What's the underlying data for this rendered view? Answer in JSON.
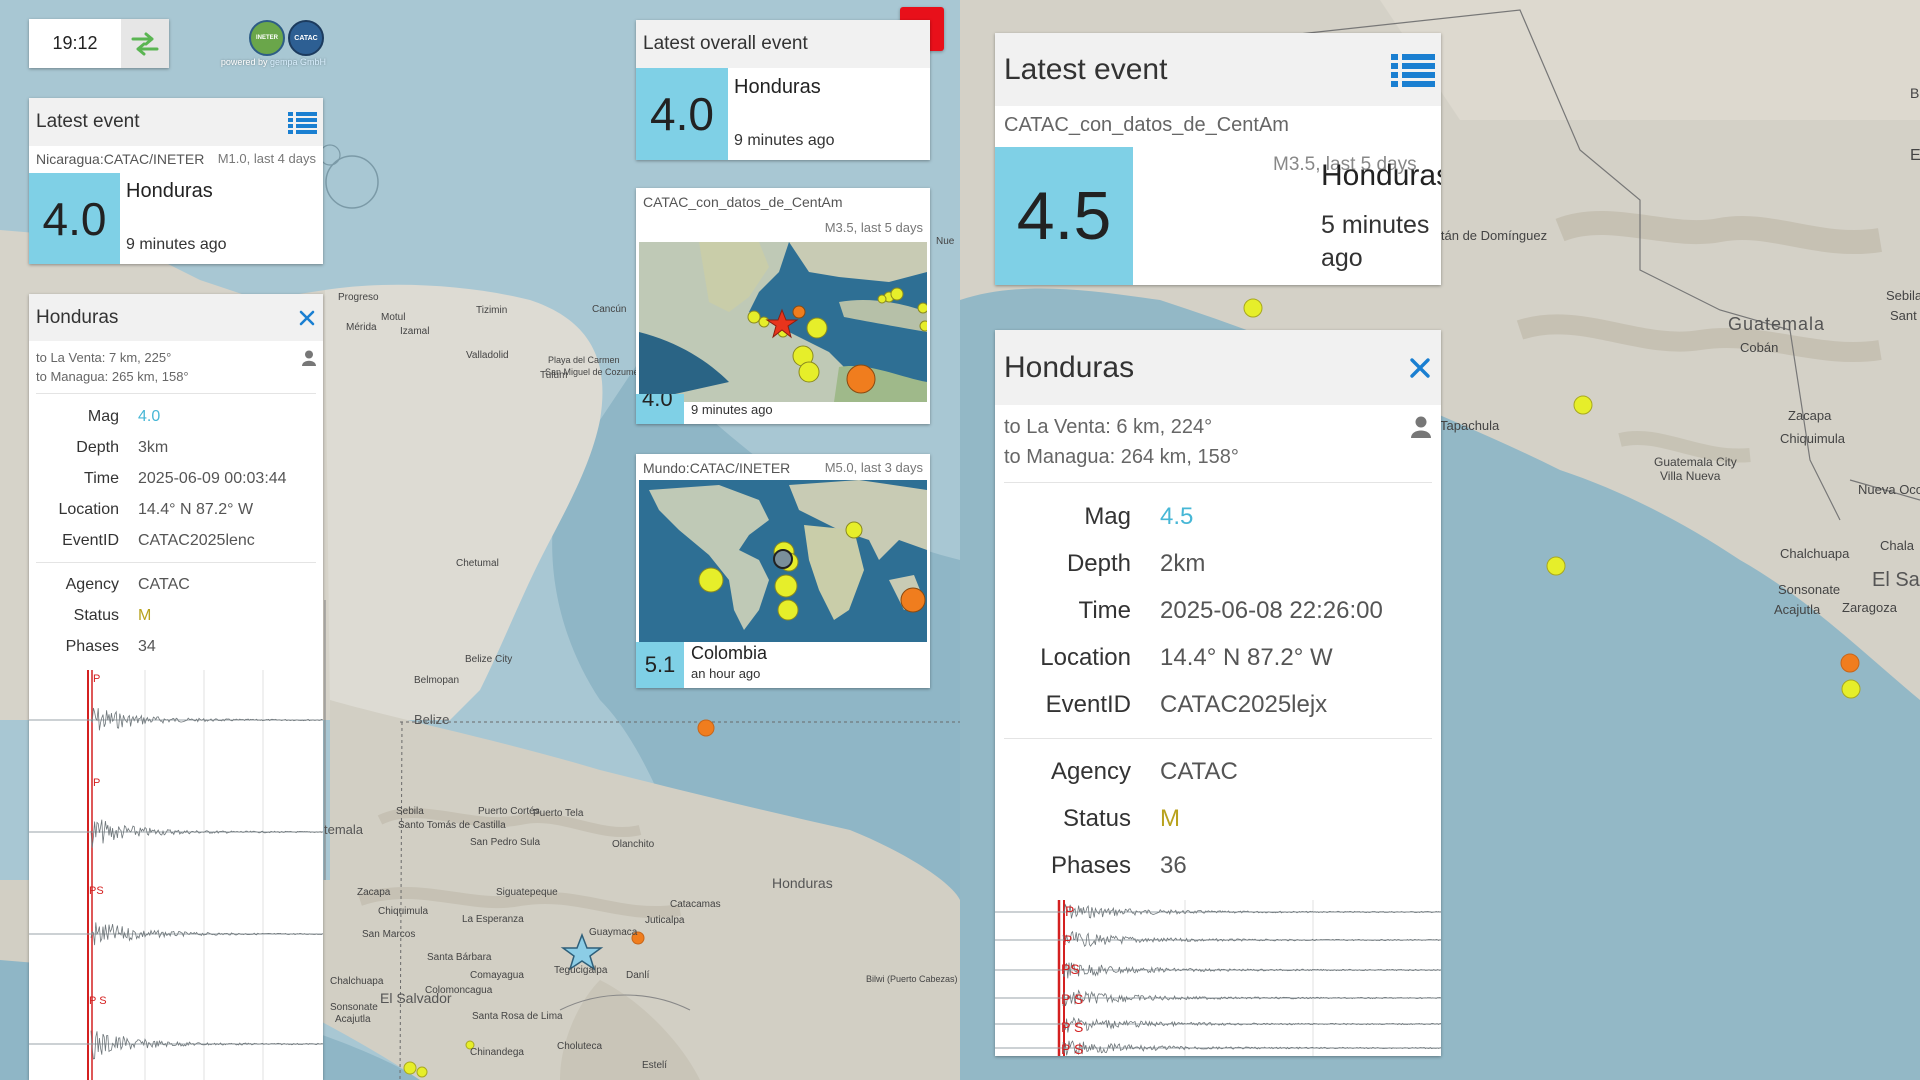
{
  "clock": {
    "time": "19:12"
  },
  "branding": {
    "powered_by": "powered by",
    "vendor": "gempa GmbH",
    "logo1_text": "INETER",
    "logo2_text": "CATAC"
  },
  "left": {
    "latest": {
      "title": "Latest event",
      "subtitle": "Nicaragua:CATAC/INETER",
      "filter": "M1.0, last 4 days",
      "mag": "4.0",
      "region": "Honduras",
      "ago": "9 minutes ago"
    },
    "detail": {
      "title": "Honduras",
      "dist1": "to La Venta: 7 km, 225°",
      "dist2": "to Managua: 265 km, 158°",
      "rows": [
        {
          "label": "Mag",
          "value": "4.0"
        },
        {
          "label": "Depth",
          "value": "3km"
        },
        {
          "label": "Time",
          "value": "2025-06-09 00:03:44"
        },
        {
          "label": "Location",
          "value": "14.4° N 87.2° W"
        },
        {
          "label": "EventID",
          "value": "CATAC2025lenc"
        }
      ],
      "rows2": [
        {
          "label": "Agency",
          "value": "CATAC"
        },
        {
          "label": "Status",
          "value": "M"
        },
        {
          "label": "Phases",
          "value": "34"
        }
      ],
      "phase_labels": [
        "P",
        "P",
        "PS",
        "P S"
      ]
    }
  },
  "middle": {
    "overall": {
      "title": "Latest overall event",
      "mag": "4.0",
      "region": "Honduras",
      "ago": "9 minutes ago"
    },
    "card1": {
      "subtitle": "CATAC_con_datos_de_CentAm",
      "filter": "M3.5, last 5 days",
      "mag_partial": "4.0",
      "ago": "9 minutes ago"
    },
    "card2": {
      "subtitle": "Mundo:CATAC/INETER",
      "filter": "M5.0, last 3 days",
      "mag": "5.1",
      "region": "Colombia",
      "ago": "an hour ago"
    },
    "map_labels": [
      "Progreso",
      "Mérida",
      "Motul",
      "Izamal",
      "Tizimin",
      "Valladolid",
      "Cancún",
      "Playa del Carmen",
      "San Miguel de Cozumel",
      "Chetumal",
      "Belize City",
      "Belmopan",
      "Belize",
      "Puerto Cortés",
      "Puerto Tela",
      "San Pedro Sula",
      "Olanchito",
      "Honduras",
      "Siguatepeque",
      "Juticalpa",
      "Catacamas",
      "Guaymaca",
      "Tegucigalpa",
      "Danlí",
      "El Salvador",
      "Santa Rosa de Lima",
      "Choluteca",
      "Chinandega",
      "Estelí",
      "Bilwi (Puerto Cabezas)",
      "Sonsonate",
      "Acajutla",
      "Chalchuapa",
      "Zacapa",
      "Chiquimula",
      "La Esperanza",
      "Colomoncagua",
      "Comayagua",
      "Santa Bárbara",
      "San Marcos",
      "Sebila",
      "Santo Tomás de Castilla",
      "temala",
      "Tulum",
      "Nue"
    ]
  },
  "right": {
    "latest": {
      "title": "Latest event",
      "subtitle": "CATAC_con_datos_de_CentAm",
      "filter": "M3.5, last 5 days",
      "mag": "4.5",
      "region": "Honduras",
      "ago": "5 minutes ago"
    },
    "detail": {
      "title": "Honduras",
      "dist1": "to La Venta: 6 km, 224°",
      "dist2": "to Managua: 264 km, 158°",
      "rows": [
        {
          "label": "Mag",
          "value": "4.5"
        },
        {
          "label": "Depth",
          "value": "2km"
        },
        {
          "label": "Time",
          "value": "2025-06-08 22:26:00"
        },
        {
          "label": "Location",
          "value": "14.4° N 87.2° W"
        },
        {
          "label": "EventID",
          "value": "CATAC2025lejx"
        }
      ],
      "rows2": [
        {
          "label": "Agency",
          "value": "CATAC"
        },
        {
          "label": "Status",
          "value": "M"
        },
        {
          "label": "Phases",
          "value": "36"
        }
      ],
      "phase_labels": [
        "P",
        "P",
        "PS",
        "P S",
        "P S",
        "P S"
      ]
    },
    "map_labels": [
      "Guatemala",
      "Cobán",
      "Tapachula",
      "Zacapa",
      "Chiquimula",
      "Guatemala City",
      "Villa Nueva",
      "Chalchuapa",
      "Sonsonate",
      "Acajutla",
      "Zaragoza",
      "El Sa",
      "Nueva Ocote",
      "Chala",
      "Sebila",
      "Sant",
      "itán de Domínguez",
      "E",
      "B"
    ]
  },
  "colors": {
    "accent": "#7fd0e6",
    "list_icon": "#1a7fd1",
    "close": "#1a7fd1",
    "status": "#b8a21e",
    "mag_text": "#47b7d6",
    "stop_button": "#e8101a",
    "quake_yellow": "#e6ee2a",
    "quake_orange": "#f07d1e",
    "quake_red": "#e8341c",
    "swap_icon": "#5ab552"
  }
}
